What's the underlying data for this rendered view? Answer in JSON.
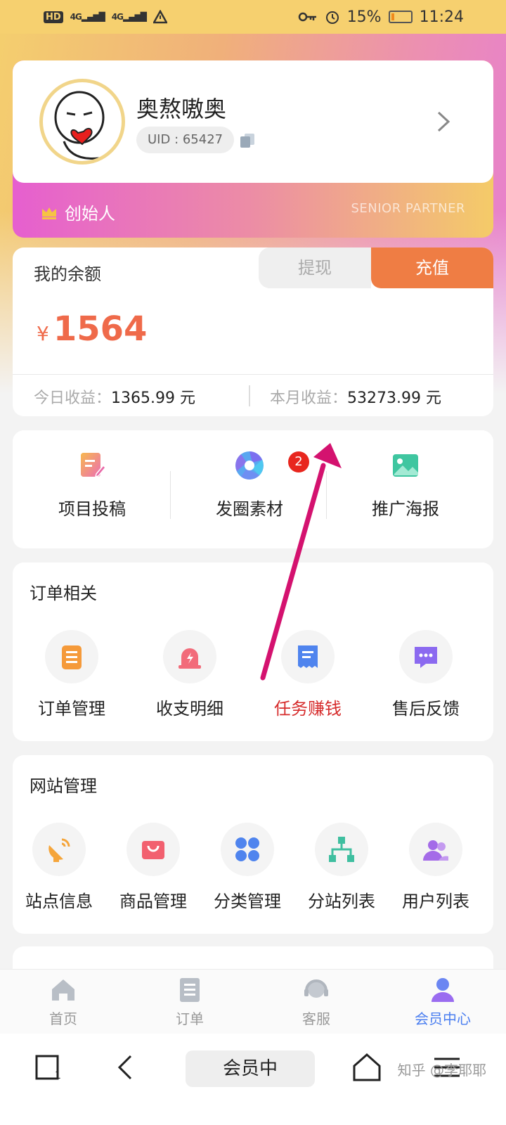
{
  "status_bar": {
    "hd": "HD",
    "sig1": "4G",
    "sig2": "4G",
    "battery_pct": "15%",
    "time": "11:24",
    "battery_level": 0.15
  },
  "profile": {
    "nickname": "奥熬嗷奥",
    "uid": "UID : 65427",
    "rank": "创始人",
    "rank_en": "SENIOR PARTNER"
  },
  "balance": {
    "title": "我的余额",
    "withdraw_label": "提现",
    "recharge_label": "充值",
    "currency": "¥",
    "amount": "1564",
    "today_label": "今日收益：",
    "today_value": "1365.99 元",
    "month_label": "本月收益：",
    "month_value": "53273.99 元"
  },
  "quick": {
    "items": [
      {
        "label": "项目投稿",
        "icon": "edit-doc-icon"
      },
      {
        "label": "发圈素材",
        "icon": "shutter-icon"
      },
      {
        "label": "推广海报",
        "icon": "image-icon"
      }
    ],
    "badge": "2"
  },
  "orders": {
    "title": "订单相关",
    "items": [
      {
        "label": "订单管理",
        "icon": "clipboard-icon"
      },
      {
        "label": "收支明细",
        "icon": "alarm-icon"
      },
      {
        "label": "任务赚钱",
        "icon": "receipt-icon"
      },
      {
        "label": "售后反馈",
        "icon": "chat-icon"
      }
    ]
  },
  "site": {
    "title": "网站管理",
    "items": [
      {
        "label": "站点信息",
        "icon": "satellite-icon"
      },
      {
        "label": "商品管理",
        "icon": "shopping-bag-icon"
      },
      {
        "label": "分类管理",
        "icon": "grid-icon"
      },
      {
        "label": "分站列表",
        "icon": "hierarchy-icon"
      },
      {
        "label": "用户列表",
        "icon": "users-icon"
      }
    ]
  },
  "tabs": [
    {
      "label": "首页",
      "icon": "home-icon"
    },
    {
      "label": "订单",
      "icon": "list-icon"
    },
    {
      "label": "客服",
      "icon": "headset-icon"
    },
    {
      "label": "会员中心",
      "icon": "member-icon"
    }
  ],
  "sysnav": {
    "url_text": "会员中",
    "watermark": "知乎 @李耶耶"
  },
  "colors": {
    "accent_orange": "#ef7d44",
    "amount_red": "#ef6a4a",
    "badge_red": "#e8261e",
    "tab_active": "#4a7ef0",
    "arrow": "#d4126f"
  }
}
